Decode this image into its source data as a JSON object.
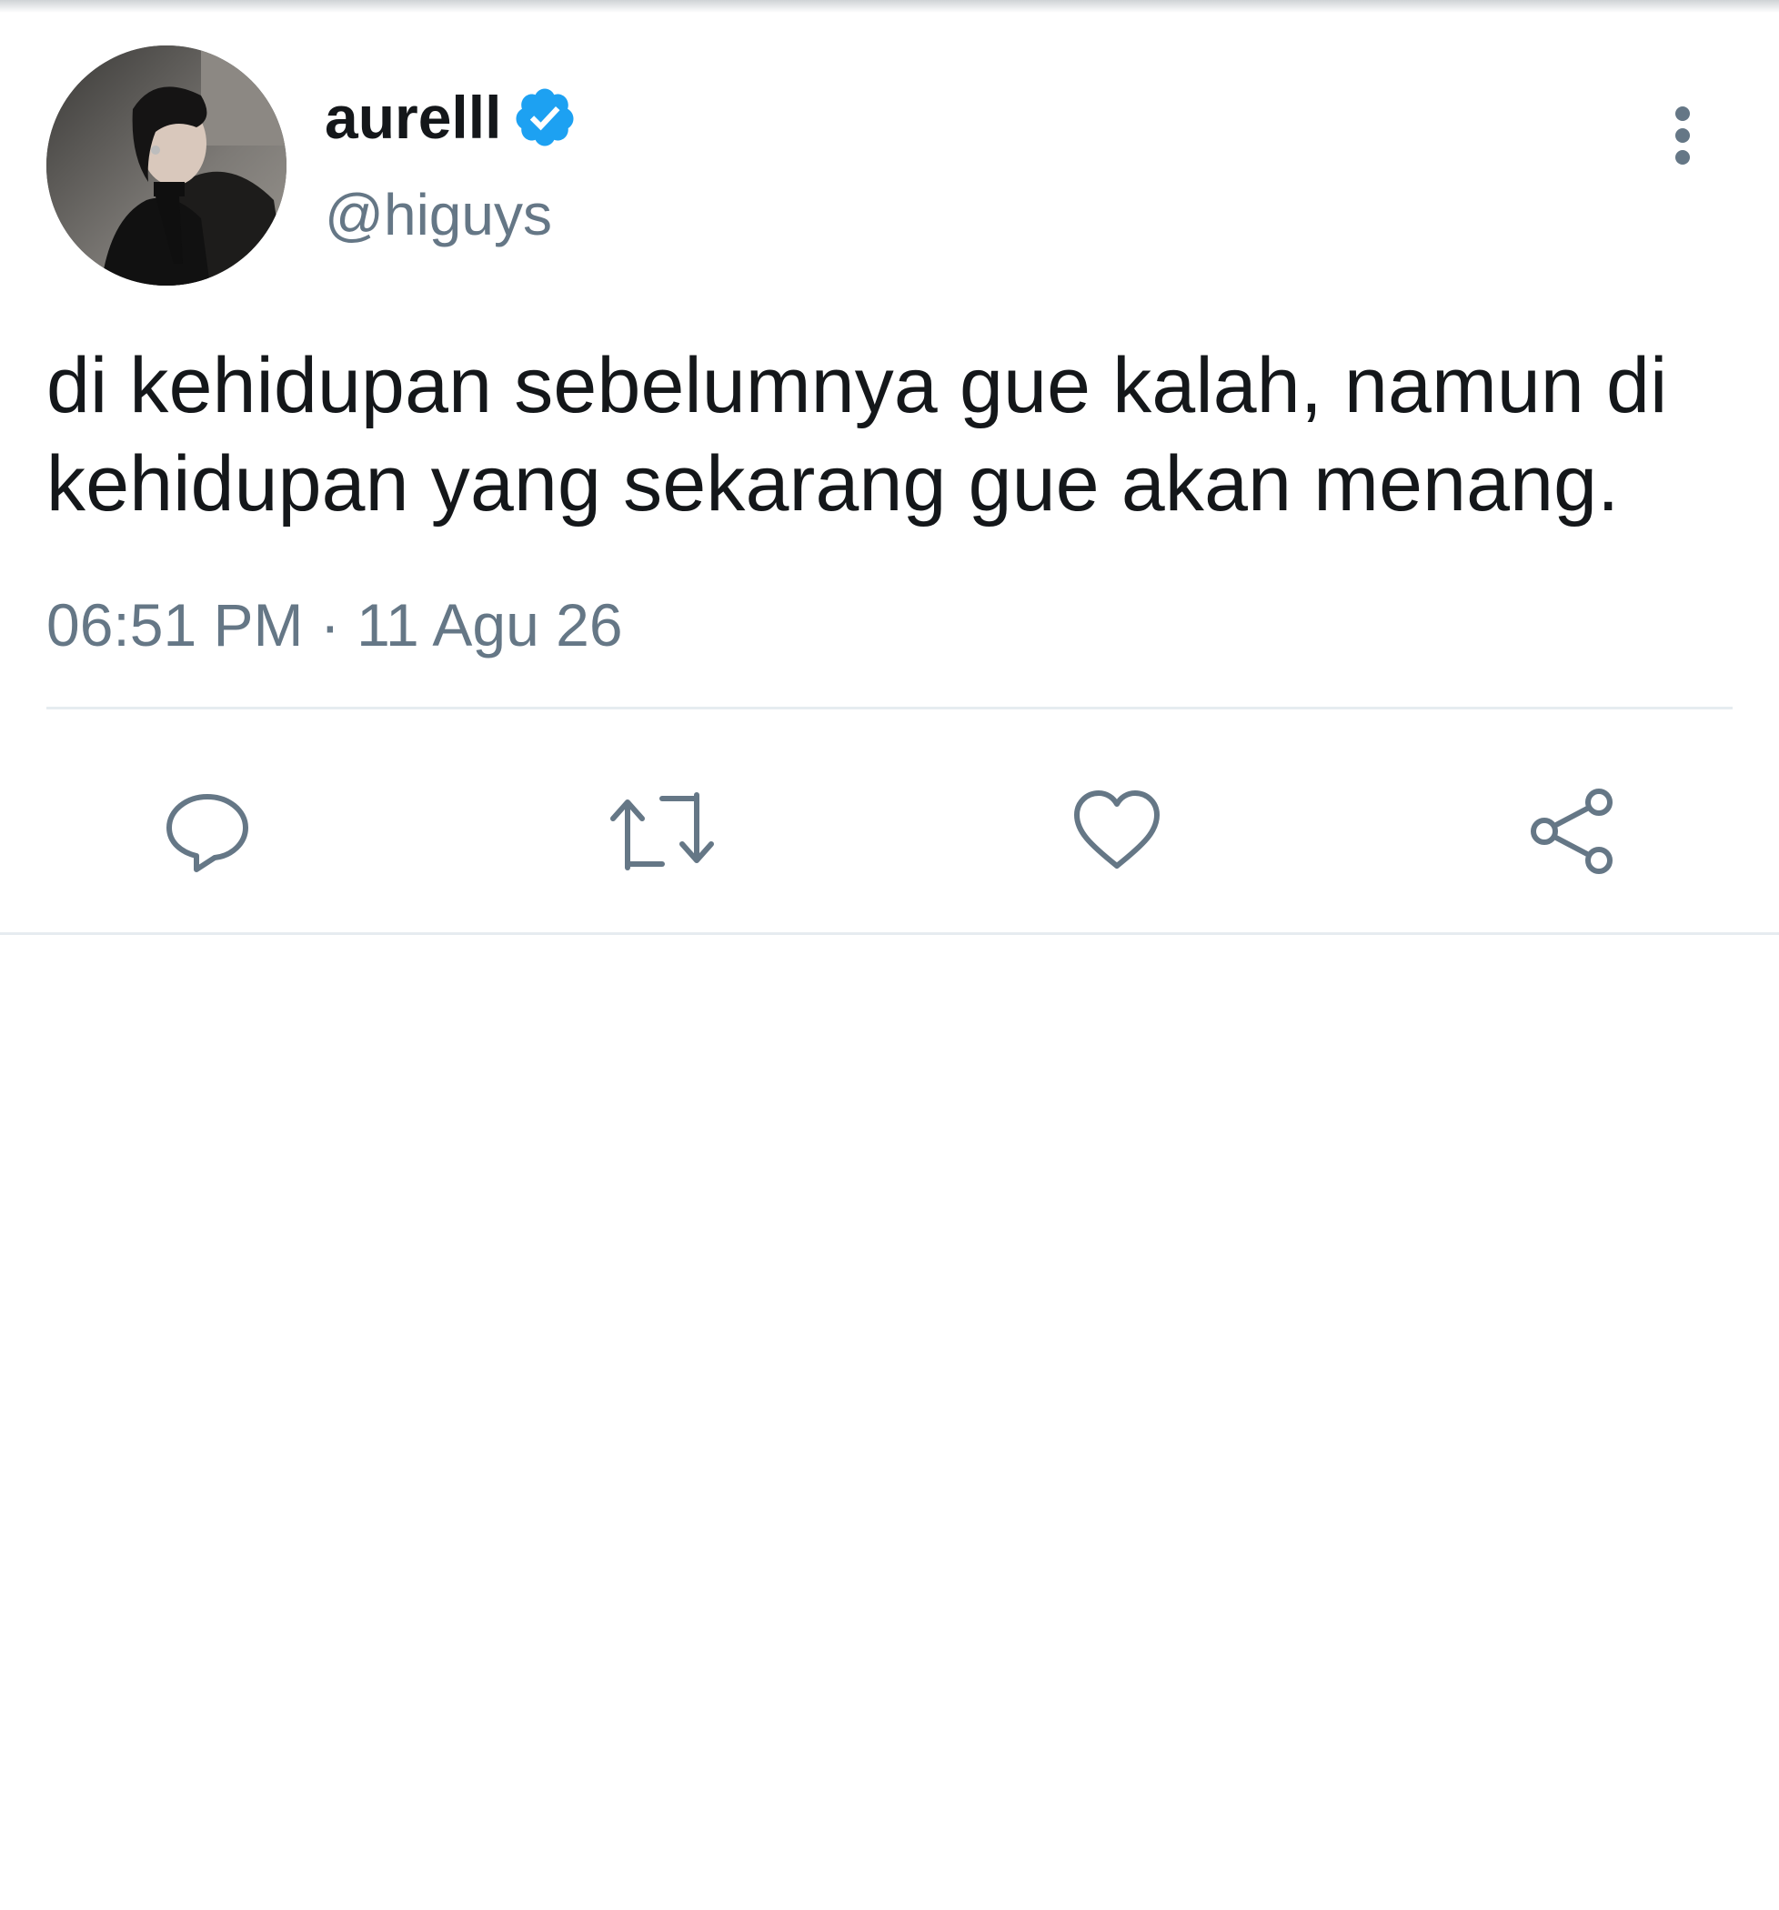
{
  "tweet": {
    "display_name": "aurelll",
    "handle": "@higuys",
    "verified": true,
    "text": "di kehidupan sebelumnya gue kalah, namun di kehidupan yang sekarang gue akan menang.",
    "time": "06:51 PM",
    "separator": "·",
    "date": "11 Agu 26"
  },
  "icons": {
    "verified": "verified-badge-icon",
    "more": "more-vertical-icon",
    "reply": "reply-icon",
    "retweet": "retweet-icon",
    "like": "heart-icon",
    "share": "share-icon"
  },
  "colors": {
    "verified": "#1da1f2",
    "icon": "#657786",
    "text": "#14171a",
    "muted": "#657786",
    "divider": "#e6ecf0"
  }
}
